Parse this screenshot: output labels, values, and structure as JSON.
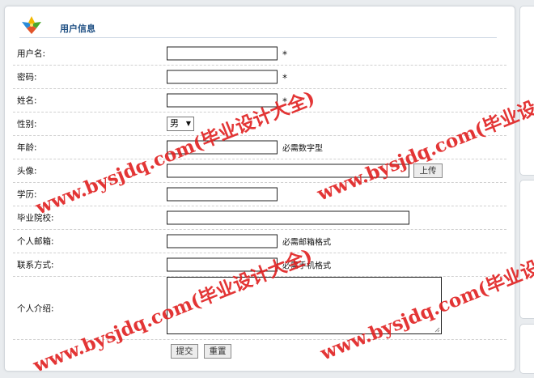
{
  "panel": {
    "title": "用户信息"
  },
  "form": {
    "username_label": "用户名:",
    "username_value": "",
    "password_label": "密码:",
    "password_value": "",
    "name_label": "姓名:",
    "name_value": "",
    "required_mark": "*",
    "gender_label": "性别:",
    "gender_selected": "男",
    "gender_arrow": "▼",
    "age_label": "年龄:",
    "age_value": "",
    "age_hint": "必需数字型",
    "avatar_label": "头像:",
    "avatar_value": "",
    "upload_label": "上传",
    "education_label": "学历:",
    "education_value": "",
    "school_label": "毕业院校:",
    "school_value": "",
    "email_label": "个人邮箱:",
    "email_value": "",
    "email_hint": "必需邮箱格式",
    "contact_label": "联系方式:",
    "contact_value": "",
    "contact_hint": "必需手机格式",
    "intro_label": "个人介绍:",
    "intro_value": "",
    "submit_label": "提交",
    "reset_label": "重置"
  },
  "watermark": {
    "text": "www.bysjdq.com(毕业设计大全)",
    "color": "#e02020"
  }
}
